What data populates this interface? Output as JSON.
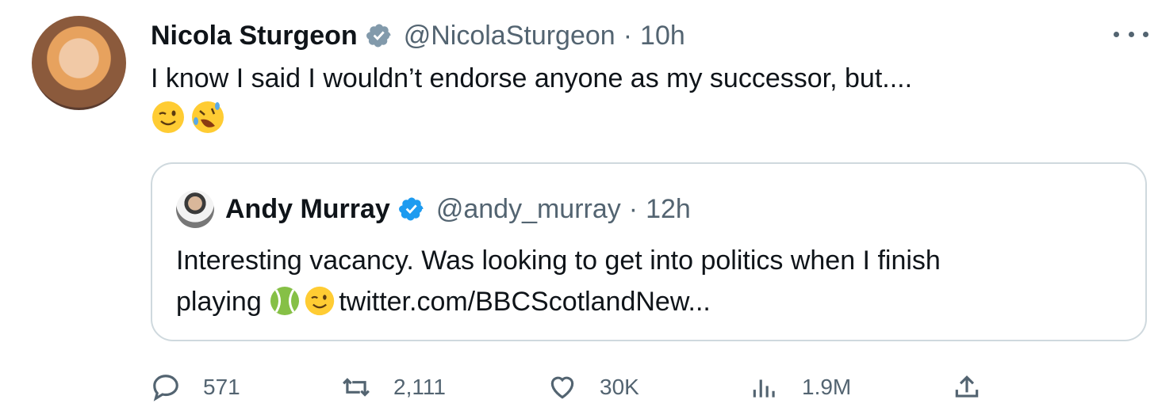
{
  "tweet": {
    "author_name": "Nicola Sturgeon",
    "author_handle": "@NicolaSturgeon",
    "separator": "·",
    "time": "10h",
    "text": "I know I said I wouldn’t endorse anyone as my successor, but....",
    "emojis": [
      "winking-face",
      "rolling-on-floor-laughing"
    ],
    "avatar": "nicola-sturgeon-avatar"
  },
  "quoted": {
    "author_name": "Andy Murray",
    "author_handle": "@andy_murray",
    "separator": "·",
    "time": "12h",
    "text_line1": "Interesting vacancy. Was looking to get into politics when I finish",
    "text_line2_prefix": "playing ",
    "link": "twitter.com/BBCScotlandNew...",
    "emojis": [
      "tennis-ball",
      "winking-face"
    ]
  },
  "actions": {
    "reply_count": "571",
    "retweet_count": "2,111",
    "like_count": "30K",
    "view_count": "1.9M"
  },
  "colors": {
    "verified_gray": "#829aab",
    "verified_blue": "#1d9bf0",
    "muted": "#536471",
    "border": "#cfd9de"
  }
}
